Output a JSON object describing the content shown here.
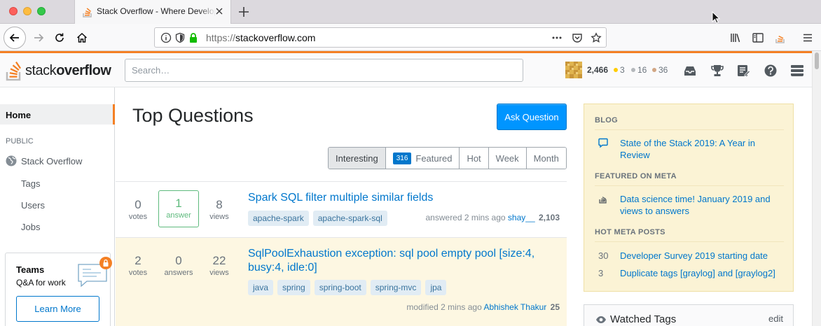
{
  "browser": {
    "tab_title": "Stack Overflow - Where Developers Learn, Share, & Build Careers",
    "url_protocol": "https://",
    "url_host": "stackoverflow.com"
  },
  "header": {
    "logo_light": "stack",
    "logo_bold": "overflow",
    "search_placeholder": "Search…",
    "reputation": "2,466",
    "gold": "3",
    "silver": "16",
    "bronze": "36"
  },
  "sidebar": {
    "home": "Home",
    "public": "PUBLIC",
    "stack_overflow": "Stack Overflow",
    "tags": "Tags",
    "users": "Users",
    "jobs": "Jobs",
    "teams_title": "Teams",
    "teams_sub": "Q&A for work",
    "learn_more": "Learn More"
  },
  "main": {
    "title": "Top Questions",
    "ask_button": "Ask Question",
    "filters": {
      "interesting": "Interesting",
      "featured_count": "316",
      "featured": "Featured",
      "hot": "Hot",
      "week": "Week",
      "month": "Month"
    },
    "questions": [
      {
        "votes": "0",
        "votes_label": "votes",
        "answers": "1",
        "answers_label": "answer",
        "views": "8",
        "views_label": "views",
        "title": "Spark SQL filter multiple similar fields",
        "tags": [
          "apache-spark",
          "apache-spark-sql"
        ],
        "action": "answered 2 mins ago",
        "user": "shay__",
        "user_rep": "2,103"
      },
      {
        "votes": "2",
        "votes_label": "votes",
        "answers": "0",
        "answers_label": "answers",
        "views": "22",
        "views_label": "views",
        "title": "SqlPoolExhaustion exception: sql pool empty pool [size:4, busy:4, idle:0]",
        "tags": [
          "java",
          "spring",
          "spring-boot",
          "spring-mvc",
          "jpa"
        ],
        "action": "modified 2 mins ago",
        "user": "Abhishek Thakur",
        "user_rep": "25"
      }
    ]
  },
  "right": {
    "blog_heading": "BLOG",
    "blog_post": "State of the Stack 2019: A Year in Review",
    "meta_heading": "FEATURED ON META",
    "meta_post": "Data science time! January 2019 and views to answers",
    "hot_heading": "HOT META POSTS",
    "hot_posts": [
      {
        "count": "30",
        "title": "Developer Survey 2019 starting date"
      },
      {
        "count": "3",
        "title": "Duplicate tags [graylog] and [graylog2]"
      }
    ],
    "watched_title": "Watched Tags",
    "watched_edit": "edit"
  },
  "colors": {
    "accent_orange": "#f48024",
    "link_blue": "#0077cc",
    "button_blue": "#0095ff",
    "answered_green": "#5eba7d",
    "highlight_row": "#fdf7e2",
    "blog_bg": "#fbf3d5"
  }
}
